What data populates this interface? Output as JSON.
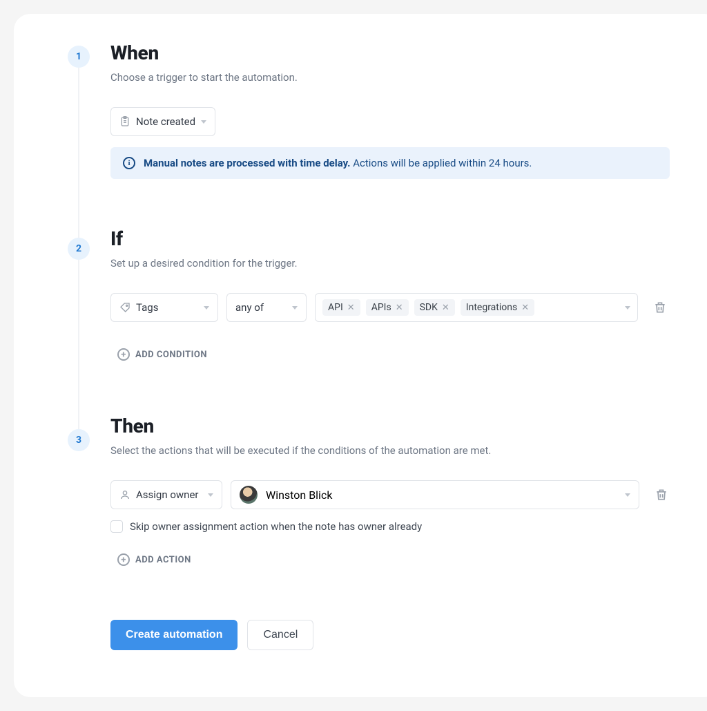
{
  "steps": [
    {
      "num": "1",
      "title": "When",
      "subtitle": "Choose a trigger to start the automation.",
      "trigger": "Note created",
      "info_bold": "Manual notes are processed with time delay.",
      "info_rest": "Actions will be applied within 24 hours."
    },
    {
      "num": "2",
      "title": "If",
      "subtitle": "Set up a desired condition for the trigger.",
      "condition_field": "Tags",
      "condition_operator": "any of",
      "condition_values": [
        "API",
        "APIs",
        "SDK",
        "Integrations"
      ],
      "add_label": "ADD CONDITION"
    },
    {
      "num": "3",
      "title": "Then",
      "subtitle": "Select the actions that will be executed if the conditions of the automation are met.",
      "action": "Assign owner",
      "owner": "Winston Blick",
      "checkbox_label": "Skip owner assignment action when the note has owner already",
      "add_label": "ADD ACTION"
    }
  ],
  "footer": {
    "primary": "Create automation",
    "secondary": "Cancel"
  }
}
